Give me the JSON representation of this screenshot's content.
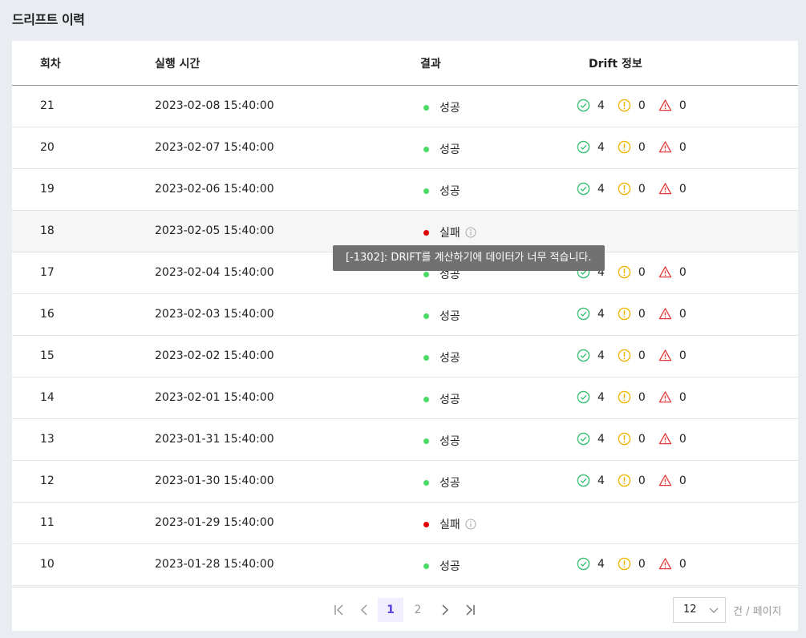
{
  "page_title": "드리프트 이력",
  "table": {
    "headers": {
      "round": "회차",
      "time": "실행 시간",
      "result": "결과",
      "drift": "Drift 정보"
    },
    "rows": [
      {
        "round": "21",
        "time": "2023-02-08 15:40:00",
        "result": "성공",
        "status": "ok",
        "ok": "4",
        "warn": "0",
        "alert": "0"
      },
      {
        "round": "20",
        "time": "2023-02-07 15:40:00",
        "result": "성공",
        "status": "ok",
        "ok": "4",
        "warn": "0",
        "alert": "0"
      },
      {
        "round": "19",
        "time": "2023-02-06 15:40:00",
        "result": "성공",
        "status": "ok",
        "ok": "4",
        "warn": "0",
        "alert": "0"
      },
      {
        "round": "18",
        "time": "2023-02-05 15:40:00",
        "result": "실패",
        "status": "fail"
      },
      {
        "round": "17",
        "time": "2023-02-04 15:40:00",
        "result": "성공",
        "status": "ok",
        "ok": "4",
        "warn": "0",
        "alert": "0"
      },
      {
        "round": "16",
        "time": "2023-02-03 15:40:00",
        "result": "성공",
        "status": "ok",
        "ok": "4",
        "warn": "0",
        "alert": "0"
      },
      {
        "round": "15",
        "time": "2023-02-02 15:40:00",
        "result": "성공",
        "status": "ok",
        "ok": "4",
        "warn": "0",
        "alert": "0"
      },
      {
        "round": "14",
        "time": "2023-02-01 15:40:00",
        "result": "성공",
        "status": "ok",
        "ok": "4",
        "warn": "0",
        "alert": "0"
      },
      {
        "round": "13",
        "time": "2023-01-31 15:40:00",
        "result": "성공",
        "status": "ok",
        "ok": "4",
        "warn": "0",
        "alert": "0"
      },
      {
        "round": "12",
        "time": "2023-01-30 15:40:00",
        "result": "성공",
        "status": "ok",
        "ok": "4",
        "warn": "0",
        "alert": "0"
      },
      {
        "round": "11",
        "time": "2023-01-29 15:40:00",
        "result": "실패",
        "status": "fail"
      },
      {
        "round": "10",
        "time": "2023-01-28 15:40:00",
        "result": "성공",
        "status": "ok",
        "ok": "4",
        "warn": "0",
        "alert": "0"
      }
    ]
  },
  "tooltip": "[-1302]: DRIFT를 계산하기에 데이터가 너무 적습니다.",
  "pagination": {
    "pages": [
      "1",
      "2"
    ],
    "current": "1",
    "page_size": "12",
    "page_size_unit": "건 / 페이지"
  },
  "icons": {
    "ok": "check-circle-icon",
    "warn": "exclamation-circle-icon",
    "alert": "warning-triangle-icon",
    "info": "info-circle-icon",
    "first": "first-page-icon",
    "prev": "chevron-left-icon",
    "next": "chevron-right-icon",
    "last": "last-page-icon",
    "dropdown": "chevron-down-icon"
  },
  "colors": {
    "success_dot": "#4cd964",
    "fail_dot": "#e00000",
    "ok_icon": "#2fbf6a",
    "warn_icon": "#f2b200",
    "alert_icon": "#e23b3b",
    "active_page": "#5a3ee0",
    "tooltip_bg": "#717171"
  }
}
